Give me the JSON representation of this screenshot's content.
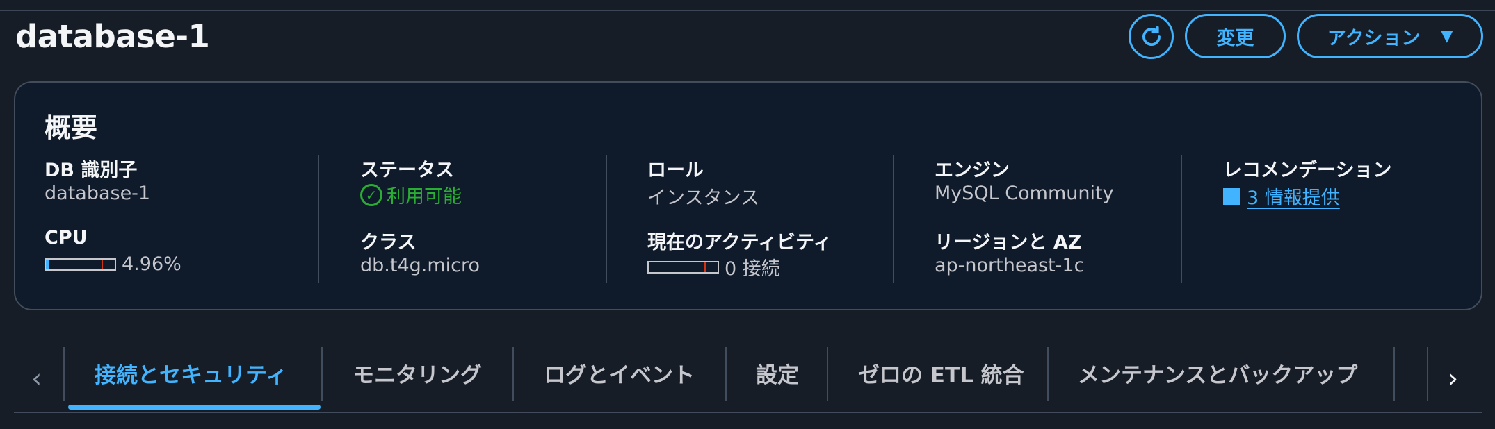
{
  "header": {
    "title": "database-1",
    "modify_label": "変更",
    "actions_label": "アクション"
  },
  "summary": {
    "title": "概要",
    "db_identifier": {
      "label": "DB 識別子",
      "value": "database-1"
    },
    "cpu": {
      "label": "CPU",
      "value": "4.96%",
      "level": 0.0496
    },
    "status": {
      "label": "ステータス",
      "value": "利用可能"
    },
    "class": {
      "label": "クラス",
      "value": "db.t4g.micro"
    },
    "role": {
      "label": "ロール",
      "value": "インスタンス"
    },
    "activity": {
      "label": "現在のアクティビティ",
      "value": "0 接続",
      "level": 0
    },
    "engine": {
      "label": "エンジン",
      "value": "MySQL Community"
    },
    "region": {
      "label": "リージョンと AZ",
      "value": "ap-northeast-1c"
    },
    "recommendations": {
      "label": "レコメンデーション",
      "value": "3 情報提供"
    }
  },
  "tabs": [
    {
      "label": "接続とセキュリティ",
      "active": true
    },
    {
      "label": "モニタリング"
    },
    {
      "label": "ログとイベント"
    },
    {
      "label": "設定"
    },
    {
      "label": "ゼロの ETL 統合"
    },
    {
      "label": "メンテナンスとバックアップ"
    }
  ],
  "colors": {
    "accent": "#42b4ff",
    "success": "#29ad32",
    "background": "#161d26",
    "card": "#0f1b2a"
  },
  "icons": {
    "refresh": "refresh-icon",
    "caret": "caret-down-icon",
    "status": "check-circle-icon",
    "prev": "chevron-left-icon",
    "next": "chevron-right-icon"
  }
}
